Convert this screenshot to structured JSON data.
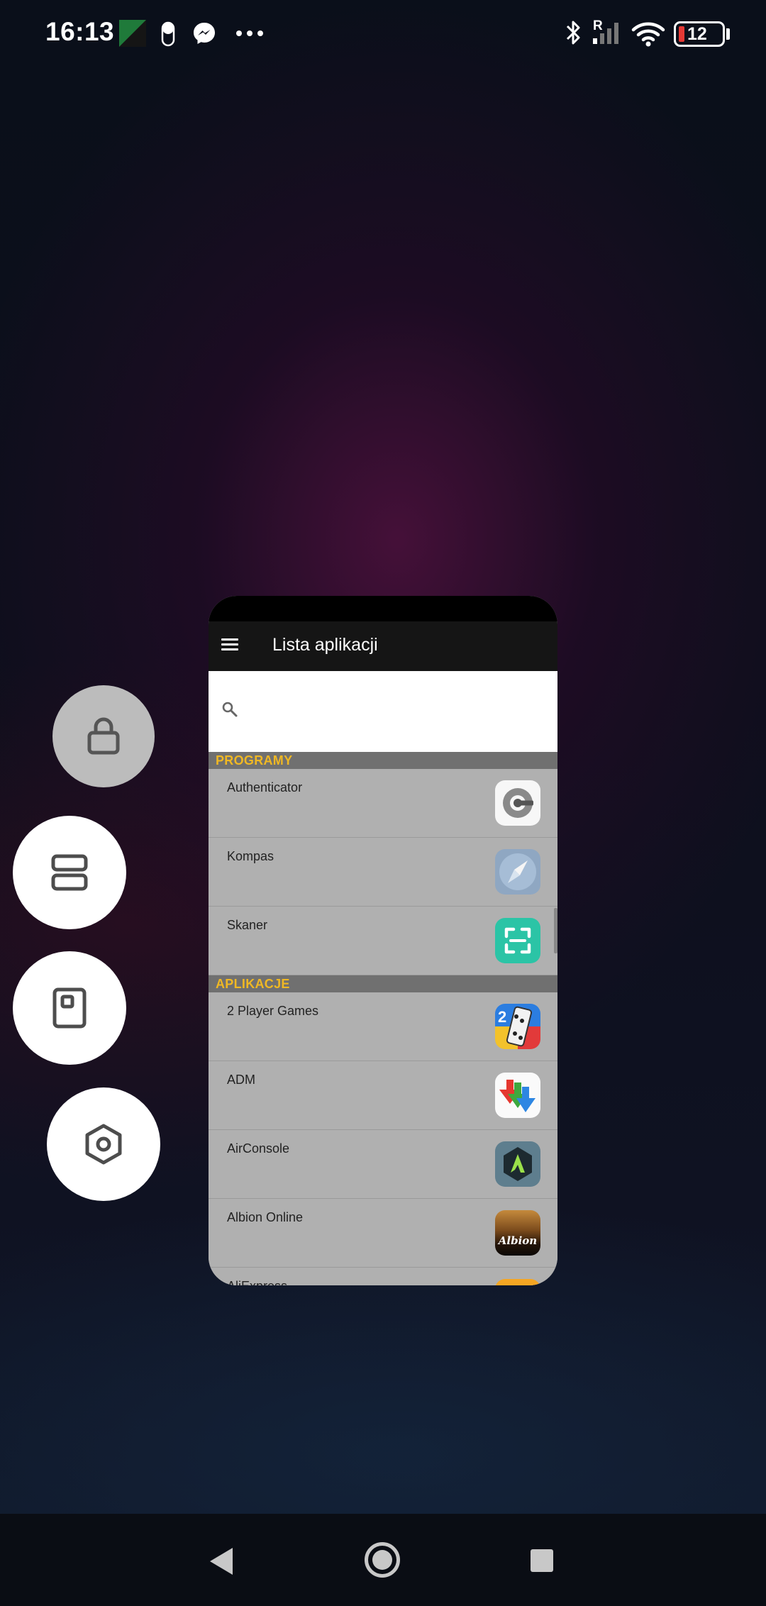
{
  "status_bar": {
    "time": "16:13",
    "battery_level": "12",
    "signal_label": "R",
    "icons": [
      "notification-image-icon",
      "pill-icon",
      "messenger-icon",
      "more-dots-icon",
      "bluetooth-icon",
      "signal-icon",
      "wifi-icon",
      "battery-icon"
    ]
  },
  "app": {
    "title": "Lista aplikacji",
    "search_placeholder": "",
    "sections": [
      {
        "header": "PROGRAMY",
        "items": [
          {
            "name": "Authenticator",
            "icon": "authenticator-icon"
          },
          {
            "name": "Kompas",
            "icon": "compass-icon"
          },
          {
            "name": "Skaner",
            "icon": "scanner-icon"
          }
        ]
      },
      {
        "header": "APLIKACJE",
        "items": [
          {
            "name": "2 Player Games",
            "icon": "two-player-games-icon"
          },
          {
            "name": "ADM",
            "icon": "adm-icon"
          },
          {
            "name": "AirConsole",
            "icon": "airconsole-icon"
          },
          {
            "name": "Albion Online",
            "icon": "albion-online-icon"
          },
          {
            "name": "AliExpress",
            "icon": "aliexpress-icon"
          }
        ]
      }
    ],
    "albion_logo_text": "Albion"
  },
  "floating_buttons": [
    "lock-icon",
    "split-screen-icon",
    "floating-window-icon",
    "settings-icon"
  ],
  "navigation": [
    "back-icon",
    "home-icon",
    "recents-icon"
  ],
  "colors": {
    "section_header_text": "#f0b823",
    "toolbar": "#151515",
    "list_background": "#b0b0b0"
  }
}
